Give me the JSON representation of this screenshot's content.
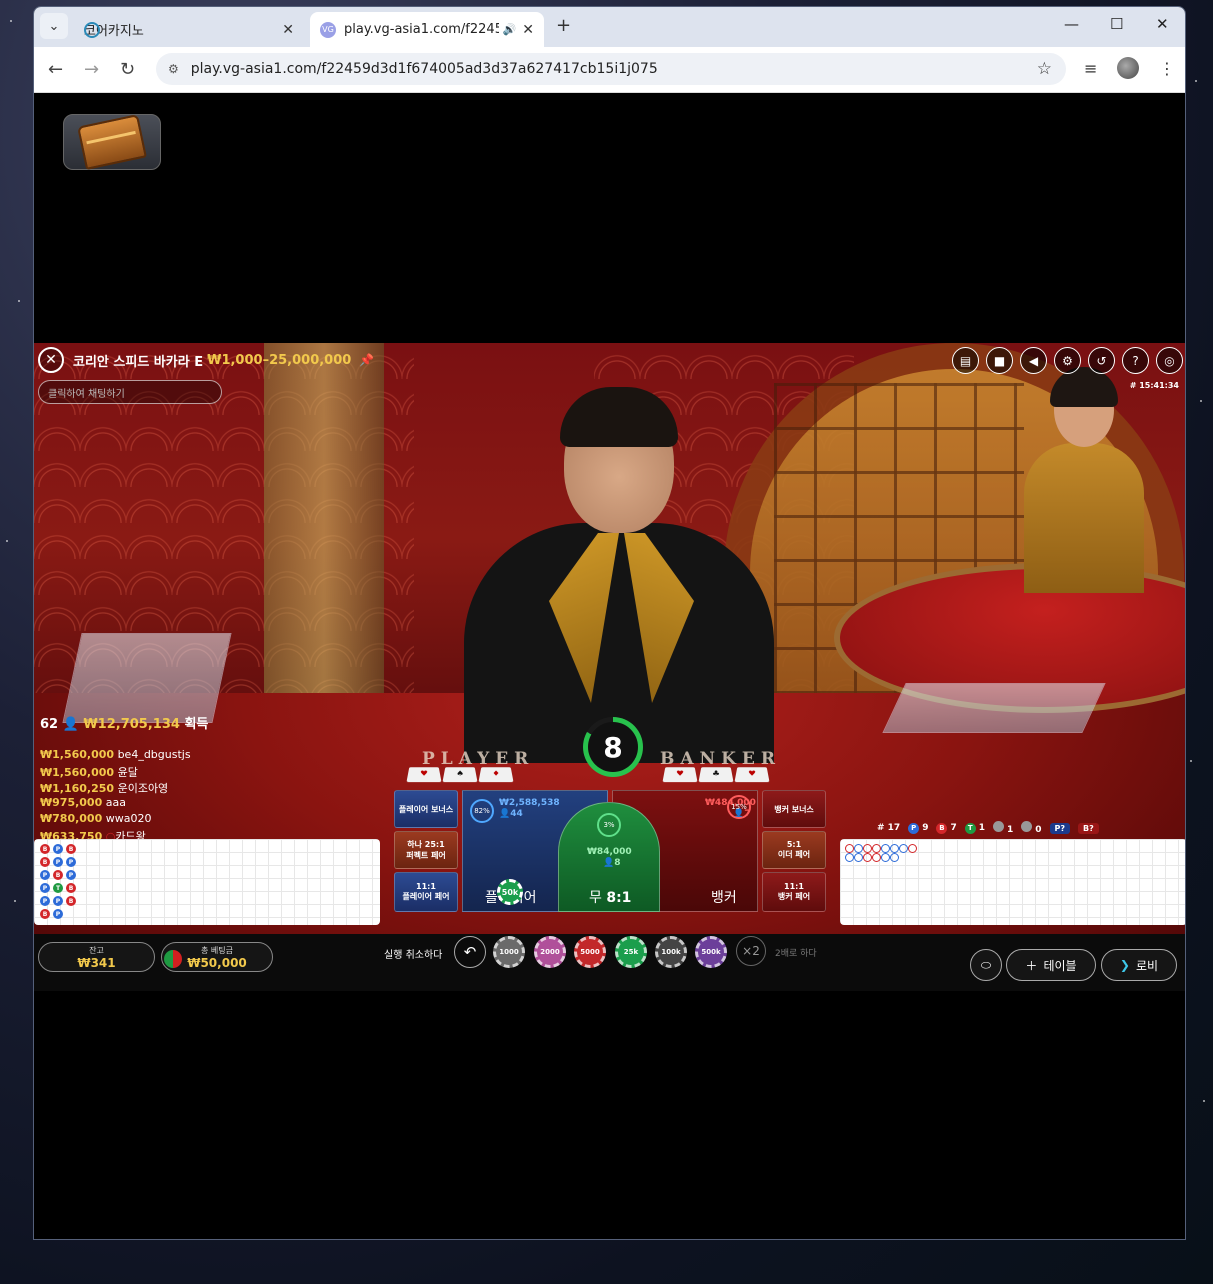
{
  "browser": {
    "tab_inactive_title": "코어카지노",
    "tab_active_title": "play.vg-asia1.com/f22459d",
    "favicon_active_text": "VG",
    "url": "play.vg-asia1.com/f22459d3d1f674005ad3d37a627417cb15i1j075"
  },
  "game": {
    "table_name": "코리안 스피드 바카라 E",
    "limits": "₩1,000–25,000,000",
    "chat_placeholder": "클릭하여 채팅하기",
    "clock": "# 15:41:34",
    "timer": "8",
    "player_label": "PLAYER",
    "banker_label": "BANKER"
  },
  "winners": {
    "count": "62",
    "total": "₩12,705,134",
    "suffix": "획득",
    "list": [
      {
        "amount": "₩1,560,000",
        "name": "be4_dbgustjs"
      },
      {
        "amount": "₩1,560,000",
        "name": "윤달"
      },
      {
        "amount": "₩1,160,250",
        "name": "운이조아영"
      },
      {
        "amount": "₩975,000",
        "name": "aaa"
      },
      {
        "amount": "₩780,000",
        "name": "wwa020"
      },
      {
        "amount": "₩633,750",
        "name": "카드왕"
      }
    ]
  },
  "bets": {
    "player_bonus": "플레이어 보너스",
    "perfect_pair_odds": "하나 25:1",
    "perfect_pair": "퍼펙트 페어",
    "player_pair_odds": "11:1",
    "player_pair": "플레이어 페어",
    "banker_bonus": "뱅커 보너스",
    "either_pair_odds": "5:1",
    "either_pair": "이더 페어",
    "banker_pair_odds": "11:1",
    "banker_pair": "뱅커 페어",
    "player_pct": "82%",
    "player_amount": "₩2,588,538",
    "player_count": "44",
    "player_name": "플레이어",
    "tie_pct": "3%",
    "tie_amount": "₩84,000",
    "tie_count": "8",
    "tie_name": "무",
    "tie_odds": "8:1",
    "banker_pct": "15%",
    "banker_amount": "₩484,000",
    "banker_count": "7",
    "banker_name": "뱅커",
    "placed_chip": "50k"
  },
  "road_stats": {
    "round": "# 17",
    "player": "9",
    "banker": "7",
    "tie": "1",
    "player_pair": "1",
    "banker_pair": "0",
    "player_predict": "P?",
    "banker_predict": "B?"
  },
  "bottom": {
    "balance_label": "잔고",
    "balance_value": "₩341",
    "total_bet_label": "총 베팅금",
    "total_bet_value": "₩50,000",
    "undo_label": "실행 취소하다",
    "chips": [
      "1000",
      "2000",
      "5000",
      "25k",
      "100k",
      "500k"
    ],
    "double_symbol": "×2",
    "double_label": "2배로 하다",
    "tables_label": "테이블",
    "lobby_label": "로비"
  },
  "colors": {
    "gold": "#f2c94c",
    "player_blue": "#2d6bd8",
    "banker_red": "#d3262a",
    "tie_green": "#1f9a42"
  },
  "bead_road": [
    [
      "B",
      "P",
      "B"
    ],
    [
      "B",
      "P",
      "P"
    ],
    [
      "P",
      "B",
      "P"
    ],
    [
      "P",
      "T",
      "B"
    ],
    [
      "P",
      "P",
      "B"
    ],
    [
      "B",
      "P"
    ]
  ]
}
